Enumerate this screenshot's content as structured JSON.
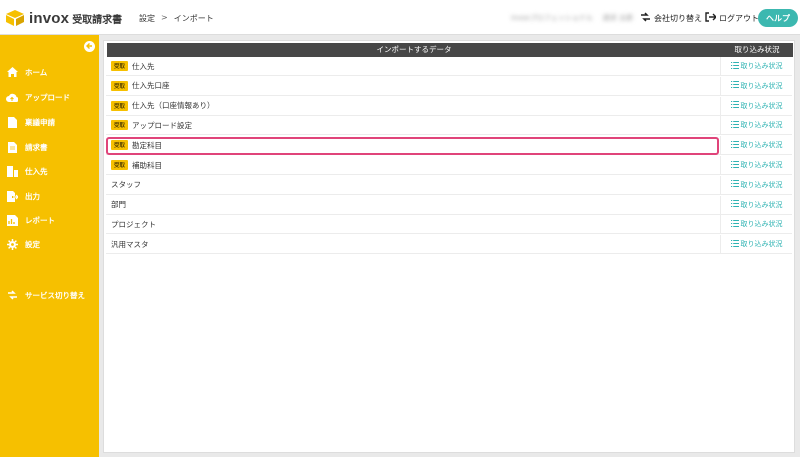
{
  "header": {
    "brand": "invox",
    "brand_sub": "受取請求書",
    "breadcrumb": [
      "設定",
      "インポート"
    ],
    "breadcrumb_sep": ">",
    "company_name": "invoxプロフェッショナル",
    "user_name": "請求 太郎",
    "switch_company": "会社切り替え",
    "logout": "ログアウト",
    "help": "ヘルプ"
  },
  "sidebar": {
    "items": [
      {
        "label": "ホーム",
        "icon": "home-icon"
      },
      {
        "label": "アップロード",
        "icon": "cloud-upload-icon"
      },
      {
        "label": "稟議申請",
        "icon": "document-icon"
      },
      {
        "label": "請求書",
        "icon": "invoice-icon"
      },
      {
        "label": "仕入先",
        "icon": "building-icon"
      },
      {
        "label": "出力",
        "icon": "export-icon"
      },
      {
        "label": "レポート",
        "icon": "report-icon"
      },
      {
        "label": "設定",
        "icon": "gear-icon"
      }
    ],
    "service_switch": "サービス切り替え"
  },
  "table": {
    "col_data": "インポートするデータ",
    "col_status": "取り込み状況",
    "status_link": "取り込み状況",
    "badge": "受取",
    "rows": [
      {
        "name": "仕入先",
        "badge": true
      },
      {
        "name": "仕入先口座",
        "badge": true
      },
      {
        "name": "仕入先（口座情報あり）",
        "badge": true
      },
      {
        "name": "アップロード設定",
        "badge": true
      },
      {
        "name": "勘定科目",
        "badge": true
      },
      {
        "name": "補助科目",
        "badge": true
      },
      {
        "name": "スタッフ",
        "badge": false
      },
      {
        "name": "部門",
        "badge": false
      },
      {
        "name": "プロジェクト",
        "badge": false
      },
      {
        "name": "汎用マスタ",
        "badge": false
      }
    ]
  },
  "colors": {
    "sidebar": "#f6c000",
    "accent": "#3cb8b0",
    "link": "#2fb3b3",
    "highlight": "#e0447a"
  }
}
